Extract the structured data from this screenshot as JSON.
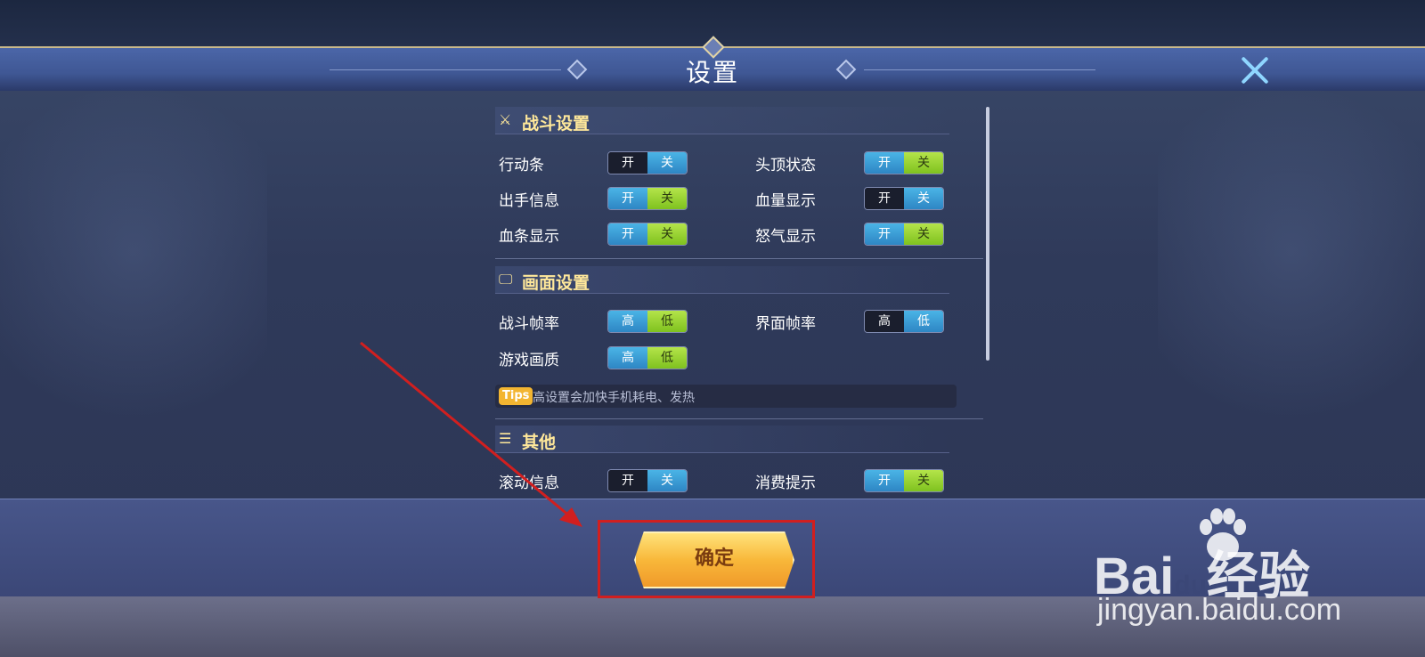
{
  "header": {
    "title": "设置"
  },
  "sections": {
    "battle": {
      "title": "战斗设置",
      "rows": [
        {
          "label": "行动条",
          "options": [
            "开",
            "关"
          ],
          "selected": "关"
        },
        {
          "label": "头顶状态",
          "options": [
            "开",
            "关"
          ],
          "selected": "开"
        },
        {
          "label": "出手信息",
          "options": [
            "开",
            "关"
          ],
          "selected": "开"
        },
        {
          "label": "血量显示",
          "options": [
            "开",
            "关"
          ],
          "selected": "关"
        },
        {
          "label": "血条显示",
          "options": [
            "开",
            "关"
          ],
          "selected": "开"
        },
        {
          "label": "怒气显示",
          "options": [
            "开",
            "关"
          ],
          "selected": "开"
        }
      ]
    },
    "display": {
      "title": "画面设置",
      "rows": [
        {
          "label": "战斗帧率",
          "options": [
            "高",
            "低"
          ],
          "selected": "高"
        },
        {
          "label": "界面帧率",
          "options": [
            "高",
            "低"
          ],
          "selected": "低"
        },
        {
          "label": "游戏画质",
          "options": [
            "高",
            "低"
          ],
          "selected": "高"
        }
      ],
      "tips_badge": "Tips",
      "tips_text": "高设置会加快手机耗电、发热"
    },
    "other": {
      "title": "其他",
      "rows": [
        {
          "label": "滚动信息",
          "options": [
            "开",
            "关"
          ],
          "selected": "关"
        },
        {
          "label": "消费提示",
          "options": [
            "开",
            "关"
          ],
          "selected": "开"
        }
      ]
    }
  },
  "footer": {
    "confirm_label": "确定"
  },
  "watermark": {
    "brand_left": "Bai",
    "brand_right": "经验",
    "brand_mid": "du",
    "url": "jingyan.baidu.com"
  },
  "colors": {
    "accent_title": "#ffe89a",
    "toggle_on": "#4ab4e6",
    "toggle_alt": "#b4e44a",
    "highlight": "#d11f1f"
  }
}
